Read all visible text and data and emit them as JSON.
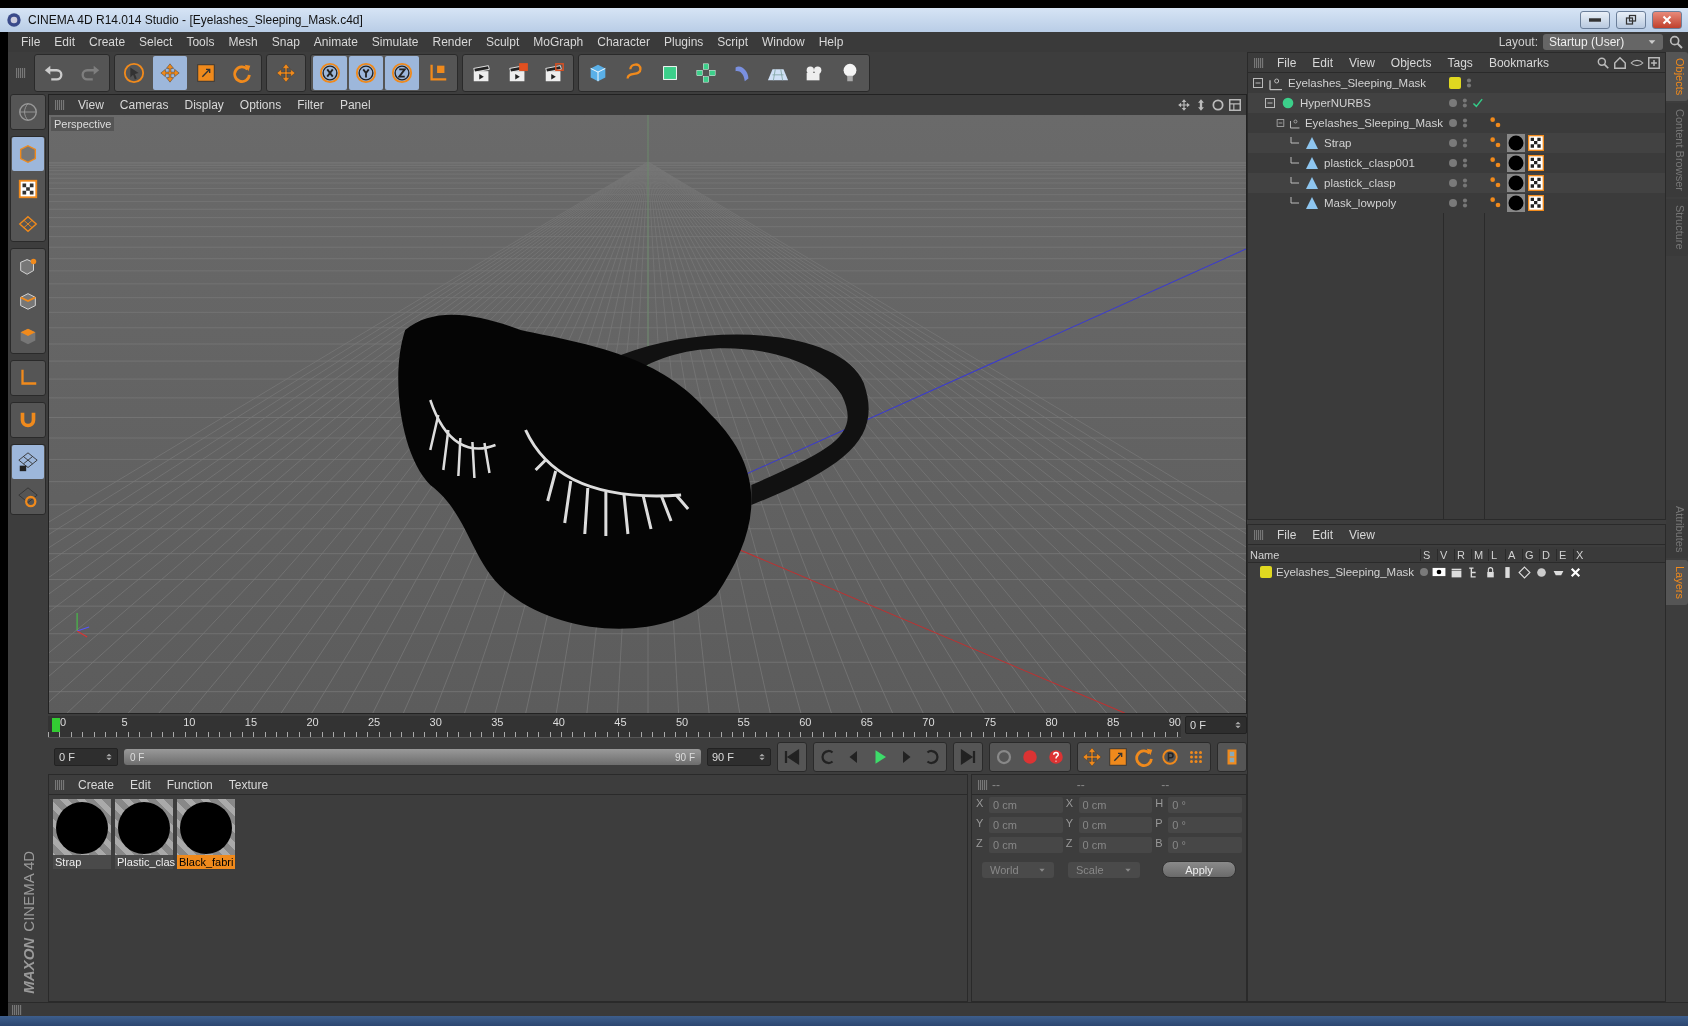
{
  "window": {
    "title": "CINEMA 4D R14.014 Studio - [Eyelashes_Sleeping_Mask.c4d]"
  },
  "menu_bar": [
    "File",
    "Edit",
    "Create",
    "Select",
    "Tools",
    "Mesh",
    "Snap",
    "Animate",
    "Simulate",
    "Render",
    "Sculpt",
    "MoGraph",
    "Character",
    "Plugins",
    "Script",
    "Window",
    "Help"
  ],
  "layout": {
    "label": "Layout:",
    "value": "Startup (User)"
  },
  "toolbar": [
    [
      {
        "kind": "undo",
        "selected": false,
        "disabled": false
      },
      {
        "kind": "redo",
        "selected": false,
        "disabled": true
      }
    ],
    [
      {
        "kind": "select",
        "selected": false,
        "disabled": false
      },
      {
        "kind": "move",
        "selected": true,
        "disabled": false
      },
      {
        "kind": "scale",
        "selected": false,
        "disabled": false
      },
      {
        "kind": "rotate",
        "selected": false,
        "disabled": false
      }
    ],
    [
      {
        "kind": "move",
        "selected": false,
        "disabled": false
      }
    ],
    [
      {
        "kind": "x",
        "selected": true,
        "disabled": false
      },
      {
        "kind": "y",
        "selected": true,
        "disabled": false
      },
      {
        "kind": "z",
        "selected": true,
        "disabled": false
      },
      {
        "kind": "coords",
        "selected": false,
        "disabled": false
      }
    ],
    [
      {
        "kind": "render-view",
        "selected": false,
        "disabled": false
      },
      {
        "kind": "render-picture",
        "selected": false,
        "disabled": false
      },
      {
        "kind": "render-settings",
        "selected": false,
        "disabled": false
      }
    ],
    [
      {
        "kind": "cube",
        "selected": false,
        "disabled": false
      },
      {
        "kind": "spline",
        "selected": false,
        "disabled": false
      },
      {
        "kind": "nurbs",
        "selected": false,
        "disabled": false
      },
      {
        "kind": "array",
        "selected": false,
        "disabled": false
      },
      {
        "kind": "deformer",
        "selected": false,
        "disabled": false
      },
      {
        "kind": "floor",
        "selected": false,
        "disabled": false
      },
      {
        "kind": "camera",
        "selected": false,
        "disabled": false
      },
      {
        "kind": "light",
        "selected": false,
        "disabled": false
      }
    ]
  ],
  "left_tools": [
    [
      {
        "kind": "globe",
        "selected": false
      }
    ],
    [
      {
        "kind": "model",
        "selected": true
      },
      {
        "kind": "checker",
        "selected": false
      },
      {
        "kind": "grid",
        "selected": false
      }
    ],
    [
      {
        "kind": "points",
        "selected": false
      },
      {
        "kind": "edges",
        "selected": false
      },
      {
        "kind": "polygons",
        "selected": false
      }
    ],
    [
      {
        "kind": "axis",
        "selected": false
      }
    ],
    [
      {
        "kind": "magnet",
        "selected": false
      }
    ],
    [
      {
        "kind": "lock-grid",
        "selected": true
      },
      {
        "kind": "grid-rotate",
        "selected": false
      }
    ]
  ],
  "brand": {
    "maker": "MAXON",
    "product": "CINEMA 4D"
  },
  "viewport": {
    "menu": [
      "View",
      "Cameras",
      "Display",
      "Options",
      "Filter",
      "Panel"
    ],
    "camera_label": "Perspective"
  },
  "timeline": {
    "ticks": [
      "0",
      "5",
      "10",
      "15",
      "20",
      "25",
      "30",
      "35",
      "40",
      "45",
      "50",
      "55",
      "60",
      "65",
      "70",
      "75",
      "80",
      "85",
      "90"
    ],
    "current_frame": "0 F",
    "start": "0 F",
    "range": {
      "start": "0 F",
      "end": "90 F",
      "level": 1
    },
    "end": "90 F"
  },
  "material_manager": {
    "menu": [
      "Create",
      "Edit",
      "Function",
      "Texture"
    ],
    "materials": [
      {
        "name": "Strap",
        "selected": false
      },
      {
        "name": "Plastic_clas",
        "selected": false
      },
      {
        "name": "Black_fabri",
        "selected": true
      }
    ]
  },
  "coordinates": {
    "headers": [
      "--",
      "--",
      "--"
    ],
    "rows": [
      {
        "position_axis": "X",
        "position": "0 cm",
        "size_axis": "X",
        "size": "0 cm",
        "rotation_axis": "H",
        "rotation": "0 °"
      },
      {
        "position_axis": "Y",
        "position": "0 cm",
        "size_axis": "Y",
        "size": "0 cm",
        "rotation_axis": "P",
        "rotation": "0 °"
      },
      {
        "position_axis": "Z",
        "position": "0 cm",
        "size_axis": "Z",
        "size": "0 cm",
        "rotation_axis": "B",
        "rotation": "0 °"
      }
    ],
    "space": "World",
    "mode": "Scale",
    "apply": "Apply"
  },
  "object_manager": {
    "menu": [
      "File",
      "Edit",
      "View",
      "Objects",
      "Tags",
      "Bookmarks"
    ],
    "tree": [
      {
        "name": "Eyelashes_Sleeping_Mask",
        "kind": "null",
        "color": "#e0d820",
        "check": false,
        "children": [
          {
            "name": "HyperNURBS",
            "kind": "nurbs",
            "check": true,
            "children": [
              {
                "name": "Eyelashes_Sleeping_Mask",
                "kind": "null",
                "check": false,
                "tags": [
                  {
                    "kind": "phong"
                  }
                ],
                "children": [
                  {
                    "name": "Strap",
                    "kind": "polygon",
                    "check": false,
                    "tags": [
                      {
                        "kind": "phong"
                      },
                      {
                        "kind": "material"
                      },
                      {
                        "kind": "uvw"
                      }
                    ]
                  },
                  {
                    "name": "plastick_clasp001",
                    "kind": "polygon",
                    "check": false,
                    "tags": [
                      {
                        "kind": "phong"
                      },
                      {
                        "kind": "material"
                      },
                      {
                        "kind": "uvw"
                      }
                    ]
                  },
                  {
                    "name": "plastick_clasp",
                    "kind": "polygon",
                    "check": false,
                    "tags": [
                      {
                        "kind": "phong"
                      },
                      {
                        "kind": "material"
                      },
                      {
                        "kind": "uvw"
                      }
                    ]
                  },
                  {
                    "name": "Mask_lowpoly",
                    "kind": "polygon",
                    "check": false,
                    "tags": [
                      {
                        "kind": "phong"
                      },
                      {
                        "kind": "material"
                      },
                      {
                        "kind": "uvw"
                      }
                    ]
                  }
                ]
              }
            ]
          }
        ]
      }
    ]
  },
  "side_tabs_top": [
    {
      "label": "Objects",
      "selected": true
    },
    {
      "label": "Content Browser",
      "selected": false
    },
    {
      "label": "Structure",
      "selected": false
    }
  ],
  "layer_manager": {
    "menu": [
      "File",
      "Edit",
      "View"
    ],
    "columns": [
      "Name",
      "S",
      "V",
      "R",
      "M",
      "L",
      "A",
      "G",
      "D",
      "E",
      "X"
    ],
    "layers": [
      {
        "name": "Eyelashes_Sleeping_Mask",
        "color": "#e0d820"
      }
    ]
  },
  "side_tabs_bottom": [
    {
      "label": "Attributes",
      "selected": false
    },
    {
      "label": "Layers",
      "selected": true
    }
  ]
}
